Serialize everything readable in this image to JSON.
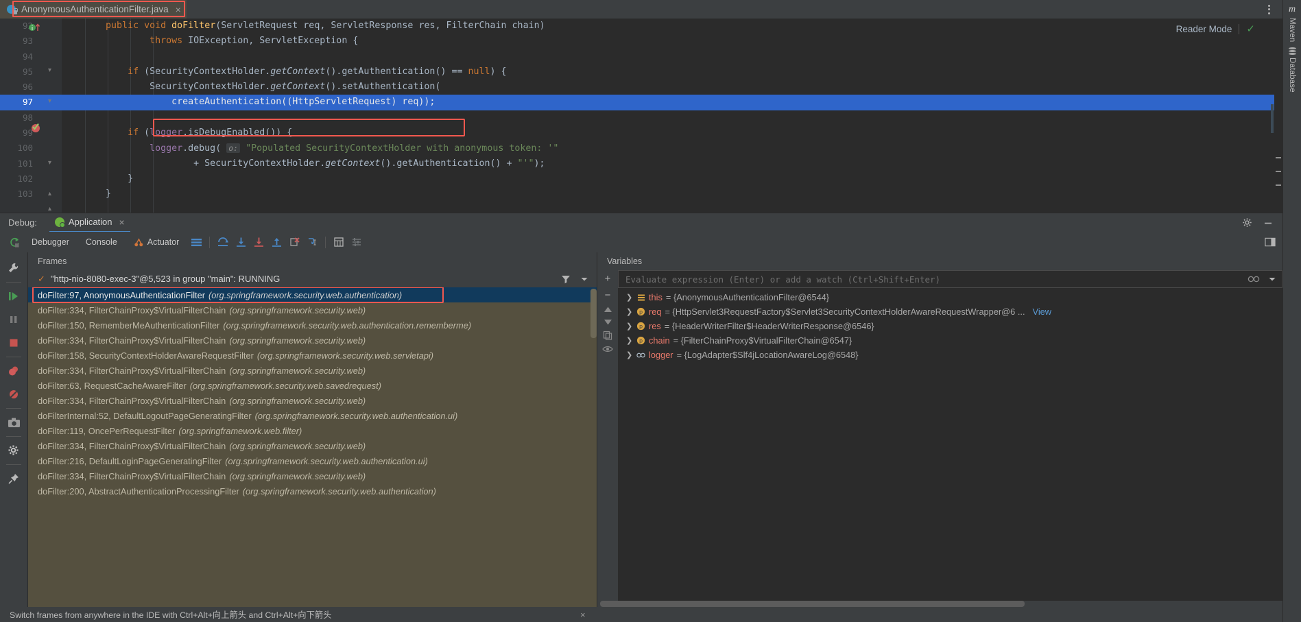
{
  "tab": {
    "title": "AnonymousAuthenticationFilter.java",
    "close_label": "×",
    "icon": "java-class-icon",
    "kebab": "more-options-icon"
  },
  "editor": {
    "reader_mode_label": "Reader Mode",
    "reader_mode_check": "✓",
    "lines": [
      {
        "num": "92",
        "tokens": [
          {
            "t": "        ",
            "c": "wht"
          },
          {
            "t": "public",
            "c": "kw"
          },
          {
            "t": " ",
            "c": "wht"
          },
          {
            "t": "void",
            "c": "kw"
          },
          {
            "t": " ",
            "c": "wht"
          },
          {
            "t": "doFilter",
            "c": "mth"
          },
          {
            "t": "(",
            "c": "wht"
          },
          {
            "t": "ServletRequest",
            "c": "id"
          },
          {
            "t": " req, ",
            "c": "wht"
          },
          {
            "t": "ServletResponse",
            "c": "id"
          },
          {
            "t": " res, ",
            "c": "wht"
          },
          {
            "t": "FilterChain",
            "c": "id"
          },
          {
            "t": " chain)",
            "c": "wht"
          }
        ]
      },
      {
        "num": "93",
        "tokens": [
          {
            "t": "                ",
            "c": "wht"
          },
          {
            "t": "throws",
            "c": "kw"
          },
          {
            "t": " ",
            "c": "wht"
          },
          {
            "t": "IOException",
            "c": "id"
          },
          {
            "t": ", ",
            "c": "wht"
          },
          {
            "t": "ServletException",
            "c": "id"
          },
          {
            "t": " {",
            "c": "wht"
          }
        ]
      },
      {
        "num": "94",
        "tokens": []
      },
      {
        "num": "95",
        "tokens": [
          {
            "t": "            ",
            "c": "wht"
          },
          {
            "t": "if",
            "c": "kw"
          },
          {
            "t": " (",
            "c": "wht"
          },
          {
            "t": "SecurityContextHolder",
            "c": "id"
          },
          {
            "t": ".",
            "c": "wht"
          },
          {
            "t": "getContext",
            "c": "it"
          },
          {
            "t": "().",
            "c": "wht"
          },
          {
            "t": "getAuthentication",
            "c": "id"
          },
          {
            "t": "() == ",
            "c": "wht"
          },
          {
            "t": "null",
            "c": "kw"
          },
          {
            "t": ") {",
            "c": "wht"
          }
        ]
      },
      {
        "num": "96",
        "tokens": [
          {
            "t": "                ",
            "c": "wht"
          },
          {
            "t": "SecurityContextHolder",
            "c": "id"
          },
          {
            "t": ".",
            "c": "wht"
          },
          {
            "t": "getContext",
            "c": "it"
          },
          {
            "t": "().",
            "c": "wht"
          },
          {
            "t": "setAuthentication",
            "c": "id"
          },
          {
            "t": "(",
            "c": "wht"
          }
        ]
      },
      {
        "num": "97",
        "tokens": [
          {
            "t": "                    ",
            "c": "wht"
          },
          {
            "t": "createAuthentication",
            "c": "id"
          },
          {
            "t": "((",
            "c": "wht"
          },
          {
            "t": "HttpServletRequest",
            "c": "id"
          },
          {
            "t": ") req));",
            "c": "wht"
          }
        ]
      },
      {
        "num": "98",
        "tokens": []
      },
      {
        "num": "99",
        "tokens": [
          {
            "t": "            ",
            "c": "wht"
          },
          {
            "t": "if",
            "c": "kw"
          },
          {
            "t": " (",
            "c": "wht"
          },
          {
            "t": "logger",
            "c": "fld"
          },
          {
            "t": ".",
            "c": "wht"
          },
          {
            "t": "isDebugEnabled",
            "c": "id"
          },
          {
            "t": "()) {",
            "c": "wht"
          }
        ]
      },
      {
        "num": "100",
        "tokens": [
          {
            "t": "                ",
            "c": "wht"
          },
          {
            "t": "logger",
            "c": "fld"
          },
          {
            "t": ".",
            "c": "wht"
          },
          {
            "t": "debug",
            "c": "id"
          },
          {
            "t": "( ",
            "c": "wht"
          },
          {
            "t": "o:",
            "c": "hint"
          },
          {
            "t": " ",
            "c": "wht"
          },
          {
            "t": "\"Populated SecurityContextHolder with anonymous token: '\"",
            "c": "str"
          }
        ]
      },
      {
        "num": "101",
        "tokens": [
          {
            "t": "                        ",
            "c": "wht"
          },
          {
            "t": "+ ",
            "c": "wht"
          },
          {
            "t": "SecurityContextHolder",
            "c": "id"
          },
          {
            "t": ".",
            "c": "wht"
          },
          {
            "t": "getContext",
            "c": "it"
          },
          {
            "t": "().",
            "c": "wht"
          },
          {
            "t": "getAuthentication",
            "c": "id"
          },
          {
            "t": "() + ",
            "c": "wht"
          },
          {
            "t": "\"'\"",
            "c": "str"
          },
          {
            "t": ");",
            "c": "wht"
          }
        ]
      },
      {
        "num": "102",
        "tokens": [
          {
            "t": "            }",
            "c": "wht"
          }
        ]
      },
      {
        "num": "103",
        "tokens": [
          {
            "t": "        }",
            "c": "wht"
          }
        ]
      }
    ],
    "highlight_line_index": 5
  },
  "debug": {
    "label": "Debug:",
    "run_config": "Application",
    "run_config_close": "×",
    "settings_icon": "gear-icon",
    "minimize_icon": "minimize-icon",
    "tabs": [
      {
        "label": "Debugger",
        "icon": ""
      },
      {
        "label": "Console",
        "icon": ""
      },
      {
        "label": "Actuator",
        "icon": "actuator-icon"
      }
    ],
    "rerun_icon": "rerun-icon",
    "toolbar_icons": [
      "layout-icon",
      "step-over-icon",
      "step-into-icon",
      "force-step-into-icon",
      "step-out-icon",
      "drop-frame-icon",
      "run-to-cursor-icon",
      "evaluate-expression-icon",
      "settings-icon"
    ],
    "right_icon": "restore-layout-icon"
  },
  "left_strip": {
    "icons": [
      "wrench-icon",
      "resume-program-icon",
      "pause-program-icon",
      "stop-icon",
      "view-breakpoints-icon",
      "mute-breakpoints-icon",
      "camera-icon",
      "settings-gear-icon",
      "pin-tab-icon"
    ]
  },
  "frames": {
    "title": "Frames",
    "filter_icon": "filter-icon",
    "dropdown_icon": "chevron-down-icon",
    "thread": "\"http-nio-8080-exec-3\"@5,523 in group \"main\": RUNNING",
    "thread_check": "✓",
    "items": [
      {
        "name": "doFilter:97, AnonymousAuthenticationFilter",
        "pkg": "(org.springframework.security.web.authentication)",
        "selected": true
      },
      {
        "name": "doFilter:334, FilterChainProxy$VirtualFilterChain",
        "pkg": "(org.springframework.security.web)",
        "selected": false
      },
      {
        "name": "doFilter:150, RememberMeAuthenticationFilter",
        "pkg": "(org.springframework.security.web.authentication.rememberme)",
        "selected": false
      },
      {
        "name": "doFilter:334, FilterChainProxy$VirtualFilterChain",
        "pkg": "(org.springframework.security.web)",
        "selected": false
      },
      {
        "name": "doFilter:158, SecurityContextHolderAwareRequestFilter",
        "pkg": "(org.springframework.security.web.servletapi)",
        "selected": false
      },
      {
        "name": "doFilter:334, FilterChainProxy$VirtualFilterChain",
        "pkg": "(org.springframework.security.web)",
        "selected": false
      },
      {
        "name": "doFilter:63, RequestCacheAwareFilter",
        "pkg": "(org.springframework.security.web.savedrequest)",
        "selected": false
      },
      {
        "name": "doFilter:334, FilterChainProxy$VirtualFilterChain",
        "pkg": "(org.springframework.security.web)",
        "selected": false
      },
      {
        "name": "doFilterInternal:52, DefaultLogoutPageGeneratingFilter",
        "pkg": "(org.springframework.security.web.authentication.ui)",
        "selected": false
      },
      {
        "name": "doFilter:119, OncePerRequestFilter",
        "pkg": "(org.springframework.web.filter)",
        "selected": false
      },
      {
        "name": "doFilter:334, FilterChainProxy$VirtualFilterChain",
        "pkg": "(org.springframework.security.web)",
        "selected": false
      },
      {
        "name": "doFilter:216, DefaultLoginPageGeneratingFilter",
        "pkg": "(org.springframework.security.web.authentication.ui)",
        "selected": false
      },
      {
        "name": "doFilter:334, FilterChainProxy$VirtualFilterChain",
        "pkg": "(org.springframework.security.web)",
        "selected": false
      },
      {
        "name": "doFilter:200, AbstractAuthenticationProcessingFilter",
        "pkg": "(org.springframework.security.web.authentication)",
        "selected": false
      }
    ]
  },
  "variables": {
    "title": "Variables",
    "eval_placeholder": "Evaluate expression (Enter) or add a watch (Ctrl+Shift+Enter)",
    "add_label": "+",
    "remove_label": "−",
    "gutter_icons": [
      "add-watch-icon",
      "remove-watch-icon",
      "move-up-icon",
      "move-down-icon",
      "copy-value-icon",
      "inspect-icon"
    ],
    "items": [
      {
        "icon": "static-field-icon",
        "name": "this",
        "value": "= {AnonymousAuthenticationFilter@6544}",
        "link": ""
      },
      {
        "icon": "parameter-icon",
        "name": "req",
        "value": "= {HttpServlet3RequestFactory$Servlet3SecurityContextHolderAwareRequestWrapper@6 ...",
        "link": "View"
      },
      {
        "icon": "parameter-icon",
        "name": "res",
        "value": "= {HeaderWriterFilter$HeaderWriterResponse@6546}",
        "link": ""
      },
      {
        "icon": "parameter-icon",
        "name": "chain",
        "value": "= {FilterChainProxy$VirtualFilterChain@6547}",
        "link": ""
      },
      {
        "icon": "field-icon",
        "name": "logger",
        "value": "= {LogAdapter$Slf4jLocationAwareLog@6548}",
        "link": ""
      }
    ]
  },
  "statusbar": {
    "message": "Switch frames from anywhere in the IDE with Ctrl+Alt+向上箭头 and Ctrl+Alt+向下箭头",
    "close": "×"
  },
  "right_strip": {
    "maven_logo": "m",
    "maven_label": "Maven",
    "database_icon": "database-icon",
    "database_label": "Database"
  },
  "colors": {
    "accent_blue": "#2f65ca",
    "highlight_red": "#f2584f",
    "selection_navy": "#113a5c",
    "frames_bg": "#55503f",
    "editor_bg": "#2b2b2b",
    "panel_bg": "#3c3f41"
  }
}
